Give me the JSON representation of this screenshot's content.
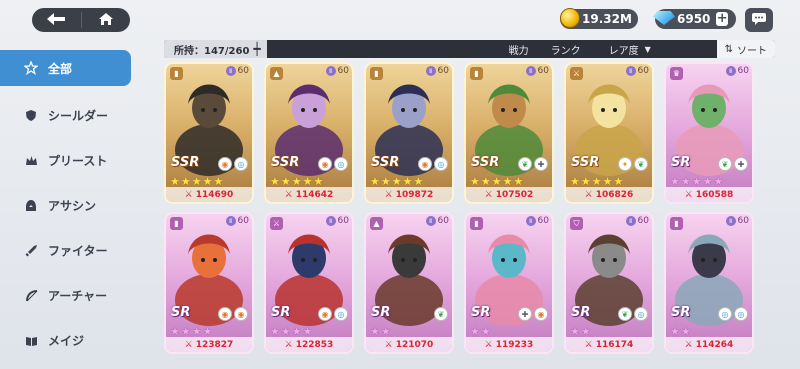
{
  "nav": {
    "back_icon": "back-arrow-icon",
    "home_icon": "home-icon"
  },
  "currency": {
    "gold": {
      "icon": "gold-coin-icon",
      "value": "19.32M"
    },
    "gems": {
      "icon": "gem-icon",
      "value": "6950",
      "add_label": "+"
    },
    "chat_icon": "chat-bubble-icon"
  },
  "sidebar": {
    "items": [
      {
        "label": "全部",
        "icon": "star-outline-icon",
        "active": true
      },
      {
        "label": "シールダー",
        "icon": "shield-icon",
        "active": false
      },
      {
        "label": "プリースト",
        "icon": "priest-crown-icon",
        "active": false
      },
      {
        "label": "アサシン",
        "icon": "assassin-hood-icon",
        "active": false
      },
      {
        "label": "ファイター",
        "icon": "sword-icon",
        "active": false
      },
      {
        "label": "アーチャー",
        "icon": "bow-icon",
        "active": false
      },
      {
        "label": "メイジ",
        "icon": "book-icon",
        "active": false
      }
    ]
  },
  "filter_bar": {
    "owned": "所持：147/260",
    "filters": [
      "戦力",
      "ランク",
      "レア度"
    ],
    "sort_label": "ソート",
    "sort_icon": "sort-icon"
  },
  "colors": {
    "accent": "#3f8fd2",
    "power_text": "#dd2233",
    "ssr_star": "#ffe04a",
    "sr_star": "#f2a8f0"
  },
  "cards": [
    {
      "rarity": "SSR",
      "level": "60",
      "stars": 5,
      "power": "114690",
      "class_icon": "book-icon",
      "elements": [
        "fire-element-icon",
        "wind-element-icon"
      ],
      "portrait": "dark-dragon-portrait"
    },
    {
      "rarity": "SSR",
      "level": "60",
      "stars": 5,
      "power": "114642",
      "class_icon": "assassin-hood-icon",
      "elements": [
        "fire-element-icon",
        "wind-element-icon"
      ],
      "portrait": "purple-witch-portrait"
    },
    {
      "rarity": "SSR",
      "level": "60",
      "stars": 5,
      "power": "109872",
      "class_icon": "book-icon",
      "elements": [
        "fire-element-icon",
        "wind-element-icon"
      ],
      "portrait": "dark-sorceress-portrait"
    },
    {
      "rarity": "SSR",
      "level": "60",
      "stars": 5,
      "power": "107502",
      "class_icon": "book-icon",
      "elements": [
        "nature-element-icon",
        "cross-element-icon"
      ],
      "portrait": "forest-druid-portrait"
    },
    {
      "rarity": "SSR",
      "level": "60",
      "stars": 5,
      "power": "106826",
      "class_icon": "sword-icon",
      "elements": [
        "light-element-icon",
        "nature-element-icon"
      ],
      "portrait": "golden-knight-portrait"
    },
    {
      "rarity": "SR",
      "level": "60",
      "stars": 5,
      "power": "160588",
      "class_icon": "priest-crown-icon",
      "elements": [
        "nature-element-icon",
        "cross-element-icon"
      ],
      "portrait": "flower-fairy-portrait"
    },
    {
      "rarity": "SR",
      "level": "60",
      "stars": 4,
      "power": "123827",
      "class_icon": "book-icon",
      "elements": [
        "fire-element-icon",
        "fire-element-icon"
      ],
      "portrait": "red-imp-portrait"
    },
    {
      "rarity": "SR",
      "level": "60",
      "stars": 4,
      "power": "122853",
      "class_icon": "sword-icon",
      "elements": [
        "fire-element-icon",
        "wind-element-icon"
      ],
      "portrait": "redhead-warrior-portrait"
    },
    {
      "rarity": "SR",
      "level": "60",
      "stars": 2,
      "power": "121070",
      "class_icon": "assassin-hood-icon",
      "elements": [
        "nature-element-icon"
      ],
      "portrait": "cyclops-portrait"
    },
    {
      "rarity": "SR",
      "level": "60",
      "stars": 2,
      "power": "119233",
      "class_icon": "book-icon",
      "elements": [
        "cross-element-icon",
        "fire-element-icon"
      ],
      "portrait": "mermaid-portrait"
    },
    {
      "rarity": "SR",
      "level": "60",
      "stars": 2,
      "power": "116174",
      "class_icon": "shield-icon",
      "elements": [
        "nature-element-icon",
        "wind-element-icon"
      ],
      "portrait": "viking-portrait"
    },
    {
      "rarity": "SR",
      "level": "60",
      "stars": 2,
      "power": "114264",
      "class_icon": "book-icon",
      "elements": [
        "wind-element-icon",
        "wind-element-icon"
      ],
      "portrait": "pale-girl-portrait"
    }
  ]
}
